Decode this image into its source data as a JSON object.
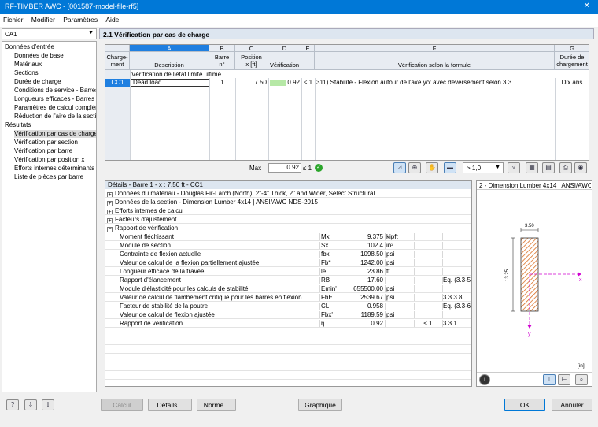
{
  "window": {
    "title": "RF-TIMBER AWC - [001587-model-file-rf5]",
    "close_glyph": "✕"
  },
  "menu": [
    "Fichier",
    "Modifier",
    "Paramètres",
    "Aide"
  ],
  "nav": {
    "case_select": "CA1",
    "group_input": "Données d'entrée",
    "input_items": [
      "Données de base",
      "Matériaux",
      "Sections",
      "Durée de charge",
      "Conditions de service - Barres",
      "Longueurs efficaces - Barres",
      "Paramètres de calcul compléme",
      "Réduction de l'aire de la section"
    ],
    "group_results": "Résultats",
    "result_items": [
      "Vérification par cas de charge",
      "Vérification par section",
      "Vérification par barre",
      "Vérification par position x",
      "Efforts internes déterminants p",
      "Liste de pièces par barre"
    ]
  },
  "header": {
    "title": "2.1  Vérification par cas de charge"
  },
  "table": {
    "letters": [
      "A",
      "B",
      "C",
      "D",
      "E",
      "F",
      "G"
    ],
    "col_load": "Charge-\nment",
    "col_desc": "Description",
    "col_bar": "Barre\nn°",
    "col_pos": "Position\nx [ft]",
    "col_check": "Vérification",
    "col_formula": "Vérification selon la formule",
    "col_duration": "Durée de\nchargement",
    "group_row": "Vérification de l'état limite ultime",
    "row": {
      "load": "CC1",
      "desc": "Dead load",
      "bar": "1",
      "pos": "7.50",
      "ratio": "0.92",
      "le": "≤ 1",
      "formula": "311) Stabilité - Flexion autour de l'axe y/x avec déversement selon 3.3",
      "duration": "Dix ans"
    },
    "ratio_value": 0.92,
    "max_label": "Max :",
    "max_value": "0.92",
    "max_le": "≤ 1",
    "zoom_select": "> 1,0"
  },
  "details": {
    "title": "Détails - Barre 1 - x : 7.50 ft - CC1",
    "sections": [
      {
        "sign": "+",
        "label": "Données du matériau - Douglas Fir-Larch (North), 2\"-4\" Thick, 2\" and Wider, Select Structural"
      },
      {
        "sign": "+",
        "label": "Données de la section - Dimension Lumber 4x14 | ANSI/AWC NDS-2015"
      },
      {
        "sign": "+",
        "label": "Efforts internes de calcul"
      },
      {
        "sign": "+",
        "label": "Facteurs d'ajustement"
      },
      {
        "sign": "−",
        "label": "Rapport de vérification"
      }
    ],
    "rows": [
      {
        "label": "Moment fléchissant",
        "sym": "Mx",
        "val": "9.375",
        "unit": "kipft",
        "le": "",
        "ref": ""
      },
      {
        "label": "Module de section",
        "sym": "Sx",
        "val": "102.4",
        "unit": "in³",
        "le": "",
        "ref": ""
      },
      {
        "label": "Contrainte de flexion actuelle",
        "sym": "fbx",
        "val": "1098.50",
        "unit": "psi",
        "le": "",
        "ref": ""
      },
      {
        "label": "Valeur de calcul de la flexion partiellement ajustée",
        "sym": "Fb*",
        "val": "1242.00",
        "unit": "psi",
        "le": "",
        "ref": ""
      },
      {
        "label": "Longueur efficace de la travée",
        "sym": "le",
        "val": "23.86",
        "unit": "ft",
        "le": "",
        "ref": ""
      },
      {
        "label": "Rapport d'élancement",
        "sym": "RB",
        "val": "17.60",
        "unit": "",
        "le": "",
        "ref": "Éq. (3.3-5"
      },
      {
        "label": "Module d'élasticité pour les calculs de stabilité",
        "sym": "Emin'",
        "val": "655500.00",
        "unit": "psi",
        "le": "",
        "ref": ""
      },
      {
        "label": "Valeur de calcul de flambement critique pour les barres en flexion",
        "sym": "FbE",
        "val": "2539.67",
        "unit": "psi",
        "le": "",
        "ref": "3.3.3.8"
      },
      {
        "label": "Facteur de stabilité de la poutre",
        "sym": "CL",
        "val": "0.958",
        "unit": "",
        "le": "",
        "ref": "Éq. (3.3-6"
      },
      {
        "label": "Valeur de calcul de flexion ajustée",
        "sym": "Fbx'",
        "val": "1189.59",
        "unit": "psi",
        "le": "",
        "ref": ""
      },
      {
        "label": "Rapport de vérification",
        "sym": "η",
        "val": "0.92",
        "unit": "",
        "le": "≤ 1",
        "ref": "3.3.1"
      }
    ]
  },
  "graphic": {
    "title": "2 - Dimension Lumber 4x14 | ANSI/AWC ...",
    "width_label": "3.50",
    "height_label": "13.25",
    "axis_y": "y",
    "axis_z": "x",
    "unit": "[in]",
    "hatch_color": "#d96a1a"
  },
  "buttons": {
    "calcul": "Calcul",
    "details": "Détails...",
    "norme": "Norme...",
    "graphique": "Graphique",
    "ok": "OK",
    "cancel": "Annuler"
  }
}
